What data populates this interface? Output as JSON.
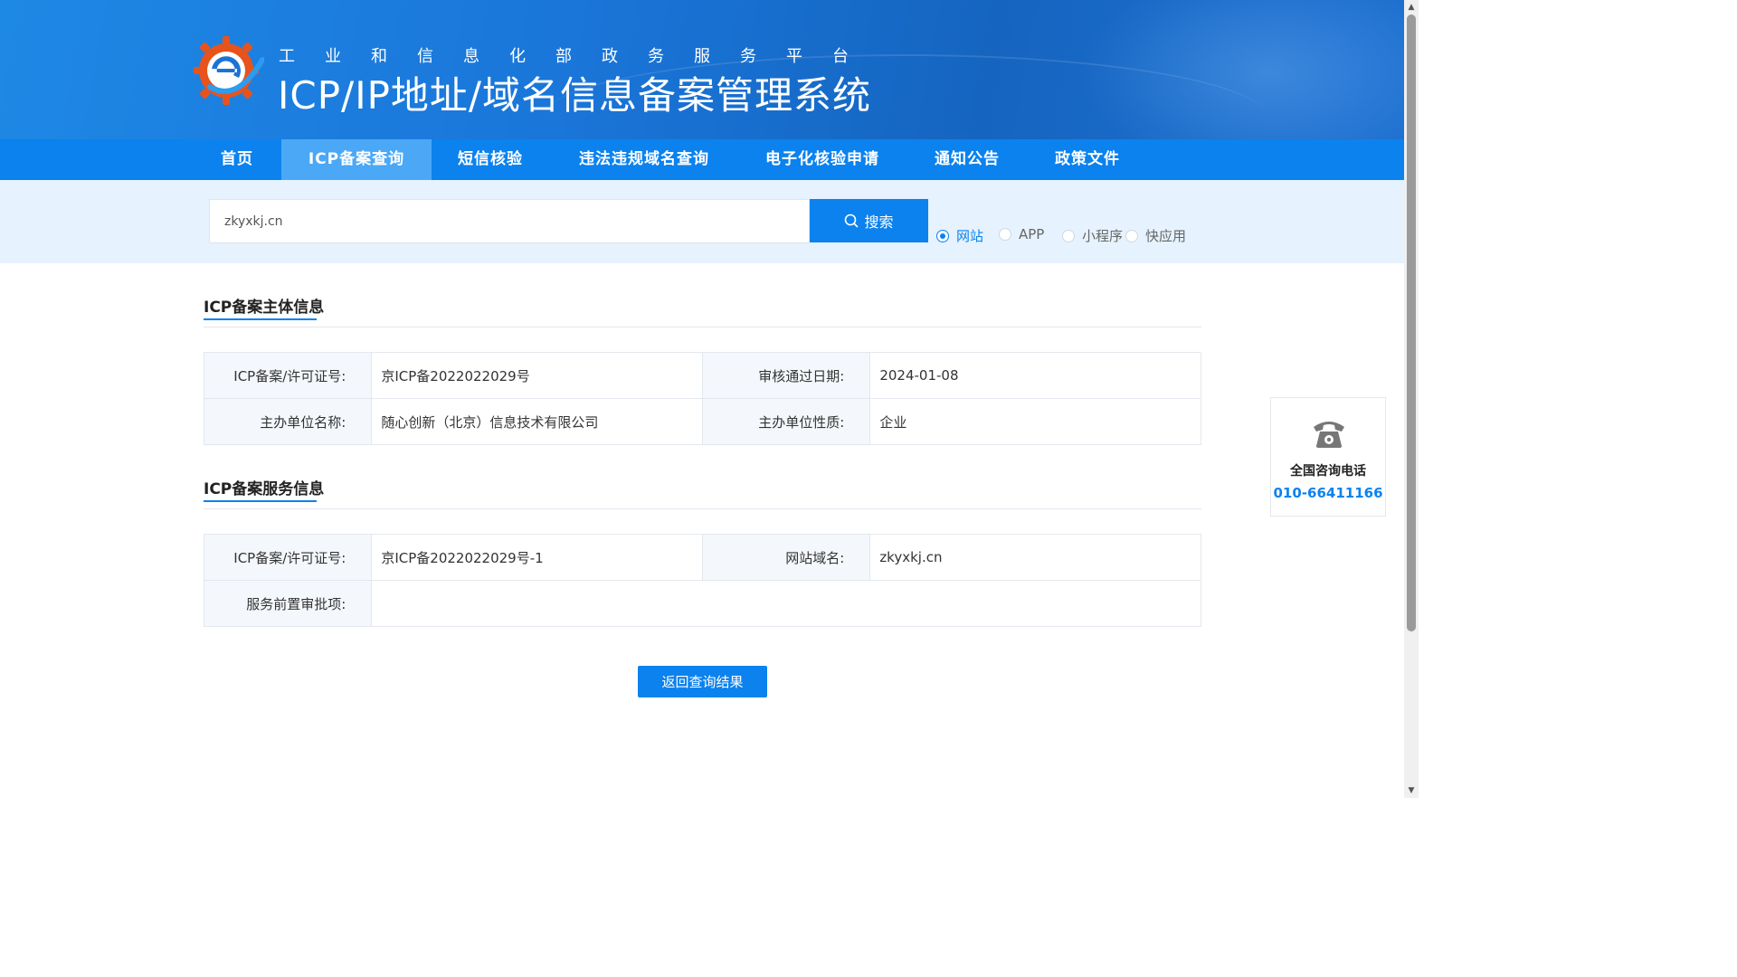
{
  "header": {
    "subtitle_chars": [
      "工",
      "业",
      "和",
      "信",
      "息",
      "化",
      "部",
      "政",
      "务",
      "服",
      "务",
      "平",
      "台"
    ],
    "title": "ICP/IP地址/域名信息备案管理系统",
    "logo_icon": "gear-e-logo-icon"
  },
  "nav": {
    "items": [
      {
        "label": "首页"
      },
      {
        "label": "ICP备案查询",
        "active": true
      },
      {
        "label": "短信核验"
      },
      {
        "label": "违法违规域名查询"
      },
      {
        "label": "电子化核验申请"
      },
      {
        "label": "通知公告"
      },
      {
        "label": "政策文件"
      }
    ]
  },
  "search": {
    "value": "zkyxkj.cn",
    "button_label": "搜索",
    "types": [
      {
        "label": "网站",
        "checked": true
      },
      {
        "label": "APP"
      },
      {
        "label": "小程序"
      },
      {
        "label": "快应用"
      }
    ]
  },
  "subject_info": {
    "title": "ICP备案主体信息",
    "rows": [
      {
        "k1": "ICP备案/许可证号:",
        "v1": "京ICP备2022022029号",
        "k2": "审核通过日期:",
        "v2": "2024-01-08"
      },
      {
        "k1": "主办单位名称:",
        "v1": "随心创新（北京）信息技术有限公司",
        "k2": "主办单位性质:",
        "v2": "企业"
      }
    ]
  },
  "service_info": {
    "title": "ICP备案服务信息",
    "row1": {
      "k1": "ICP备案/许可证号:",
      "v1": "京ICP备2022022029号-1",
      "k2": "网站域名:",
      "v2": "zkyxkj.cn"
    },
    "row2": {
      "k1": "服务前置审批项:",
      "v1": ""
    }
  },
  "back_button_label": "返回查询结果",
  "contact": {
    "label": "全国咨询电话",
    "phone": "010-66411166",
    "icon": "telephone-icon"
  },
  "colors": {
    "primary": "#0b82ee",
    "nav_active": "#4aa8f7",
    "search_band": "#e6f2fd"
  }
}
